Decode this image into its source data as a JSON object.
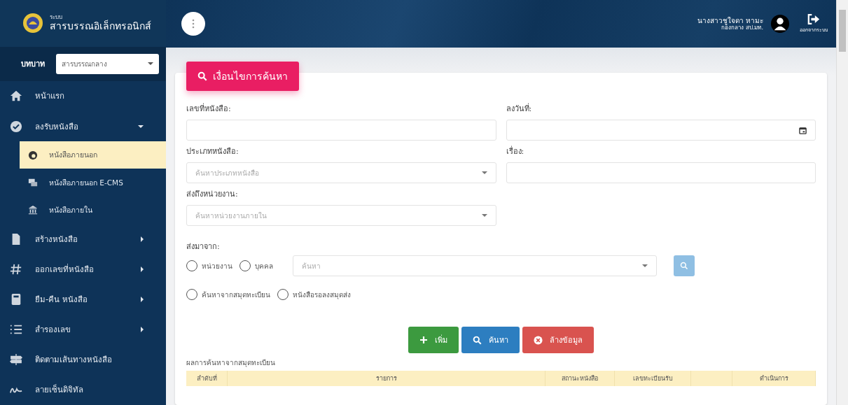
{
  "brand": {
    "small": "ระบบ",
    "title": "สารบรรณอิเล็กทรอนิกส์"
  },
  "role": {
    "label": "บทบาท",
    "value": "สารบรรณกลาง"
  },
  "menu": [
    {
      "label": "หน้าแรก"
    },
    {
      "label": "ลงรับหนังสือ",
      "expanded": true,
      "children": [
        {
          "label": "หนังสือภายนอก",
          "selected": true
        },
        {
          "label": "หนังสือภายนอก E-CMS",
          "selected": false
        },
        {
          "label": "หนังสือภายใน",
          "selected": false
        }
      ]
    },
    {
      "label": "สร้างหนังสือ",
      "expanded": false
    },
    {
      "label": "ออกเลขที่หนังสือ",
      "expanded": false
    },
    {
      "label": "ยืม-คืน หนังสือ",
      "expanded": false
    },
    {
      "label": "สำรองเลข",
      "expanded": false
    },
    {
      "label": "ติดตามเส้นทางหนังสือ"
    },
    {
      "label": "ลายเซ็นดิจิทัล"
    }
  ],
  "user": {
    "name": "นางสาวชูใจดา หามะ",
    "unit": "กองกลาง สป.มท.",
    "logout": "ออกจากระบบ"
  },
  "card": {
    "title": "เงื่อนไขการค้นหา"
  },
  "fields": [
    {
      "label": "เลขที่หนังสือ:",
      "kind": "text"
    },
    {
      "label": "ลงวันที่:",
      "kind": "date"
    },
    {
      "label": "ประเภทหนังสือ:",
      "kind": "select",
      "placeholder": "ค้นหาประเภทหนังสือ"
    },
    {
      "label": "เรื่อง:",
      "kind": "text"
    },
    {
      "label": "ส่งถึงหน่วยงาน:",
      "kind": "select",
      "placeholder": "ค้นหาหน่วยงานภายใน"
    }
  ],
  "sender": {
    "label": "ส่งมาจาก:",
    "options": [
      {
        "label": "หน่วยงาน",
        "selected": false
      },
      {
        "label": "บุคคล",
        "selected": false
      }
    ],
    "placeholder": "ค้นหา"
  },
  "source_options": [
    {
      "label": "ค้นหาจากสมุดทะเบียน",
      "selected": false
    },
    {
      "label": "หนังสือรอลงสมุดส่ง",
      "selected": false
    }
  ],
  "buttons": [
    {
      "label": "เพิ่ม",
      "kind": "add"
    },
    {
      "label": "ค้นหา",
      "kind": "search"
    },
    {
      "label": "ล้างข้อมูล",
      "kind": "clear"
    }
  ],
  "results": {
    "title": "ผลการค้นหาจากสมุดทะเบียน",
    "columns": [
      "ลำดับที่",
      "รายการ",
      "สถานะหนังสือ",
      "เลขทะเบียนรับ",
      "",
      "ดำเนินการ"
    ]
  }
}
